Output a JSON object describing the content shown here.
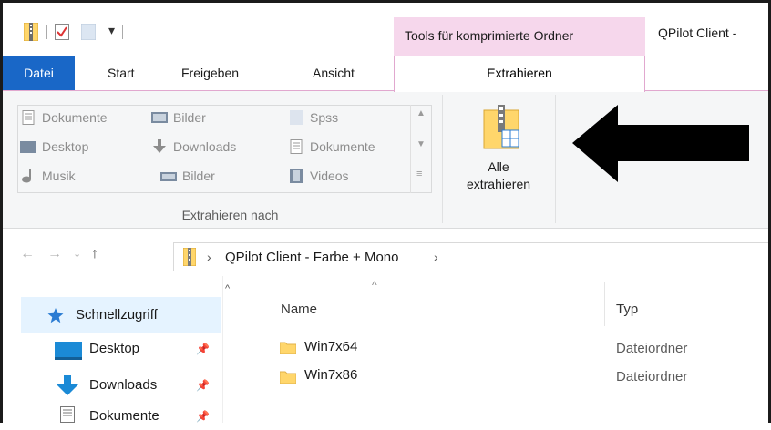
{
  "title_bar": {
    "context_tab": "Tools für komprimierte Ordner",
    "window_title": "QPilot Client -"
  },
  "ribbon_tabs": {
    "file": "Datei",
    "start": "Start",
    "share": "Freigeben",
    "view": "Ansicht",
    "extract": "Extrahieren"
  },
  "extract_to": {
    "items": [
      {
        "label": "Dokumente",
        "icon": "document-icon"
      },
      {
        "label": "Bilder",
        "icon": "picture-icon"
      },
      {
        "label": "Spss",
        "icon": "folder-icon"
      },
      {
        "label": "Desktop",
        "icon": "desktop-icon"
      },
      {
        "label": "Downloads",
        "icon": "download-icon"
      },
      {
        "label": "Dokumente",
        "icon": "document-icon"
      },
      {
        "label": "Musik",
        "icon": "music-icon"
      },
      {
        "label": "Bilder",
        "icon": "picture-icon"
      },
      {
        "label": "Videos",
        "icon": "video-icon"
      }
    ],
    "group_label": "Extrahieren nach"
  },
  "extract_all": {
    "line1": "Alle",
    "line2": "extrahieren"
  },
  "address_bar": {
    "path": "QPilot Client - Farbe + Mono"
  },
  "nav_pane": {
    "quick_access": "Schnellzugriff",
    "items": [
      {
        "label": "Desktop"
      },
      {
        "label": "Downloads"
      },
      {
        "label": "Dokumente"
      }
    ]
  },
  "file_list": {
    "columns": {
      "name": "Name",
      "type": "Typ"
    },
    "rows": [
      {
        "name": "Win7x64",
        "type": "Dateiordner"
      },
      {
        "name": "Win7x86",
        "type": "Dateiordner"
      }
    ]
  },
  "colors": {
    "accent_blue": "#1967c7",
    "context_pink": "#f6d7ec",
    "folder_yellow": "#ffd66b"
  }
}
